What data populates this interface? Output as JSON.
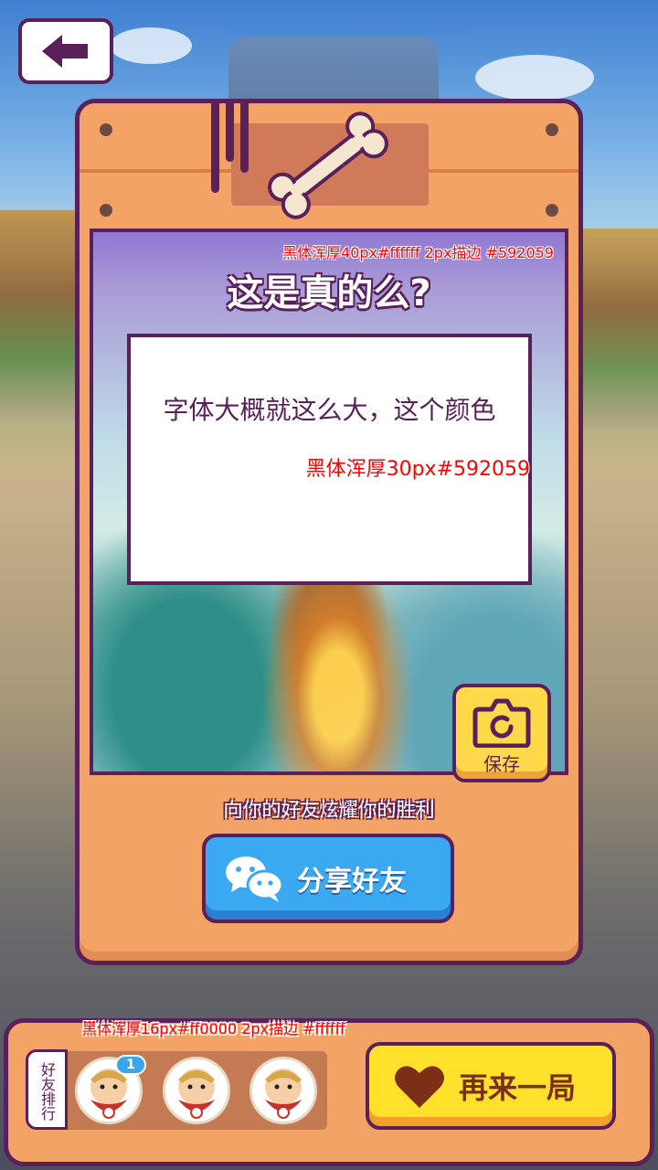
{
  "header": {
    "back_icon": "arrow-left-icon"
  },
  "card": {
    "title_note": "黑体浑厚40px#ffffff  2px描边 #592059",
    "question": "这是真的么?",
    "answer_text": "字体大概就这么大，这个颜色",
    "answer_note": "黑体浑厚30px#592059"
  },
  "save": {
    "label": "保存",
    "icon": "camera-icon"
  },
  "share": {
    "prompt": "向你的好友炫耀你的胜利",
    "label": "分享好友",
    "icon": "wechat-icon"
  },
  "bottom": {
    "rank_note": "黑体浑厚16px#ff0000  2px描边 #ffffff",
    "rank_label": "好友排行",
    "friend_badge": "1",
    "friends": [
      "friend-avatar-1",
      "friend-avatar-2",
      "friend-avatar-3"
    ],
    "again_label": "再来一局",
    "again_icon": "heart-icon"
  },
  "colors": {
    "primary_text": "#592059",
    "note_red": "#ff0000",
    "board": "#f4a366",
    "share_blue": "#3ba8f2",
    "again_yellow": "#ffe02a"
  }
}
